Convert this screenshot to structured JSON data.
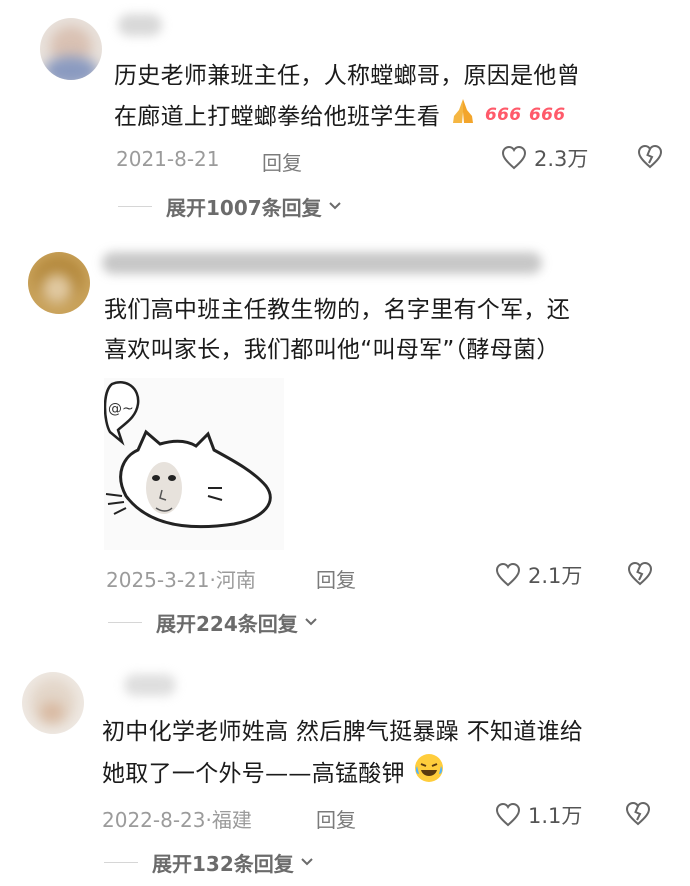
{
  "comments": [
    {
      "text_line1": "历史老师兼班主任，人称螳螂哥，原因是他曾",
      "text_line2": "在廊道上打螳螂拳给他班学生看",
      "emojis": [
        "praying-hands-emoji",
        "666-emoji",
        "666-emoji"
      ],
      "date": "2021-8-21",
      "location": "",
      "reply_label": "回复",
      "likes": "2.3万",
      "expand_label": "展开1007条回复"
    },
    {
      "text_line1": "我们高中班主任教生物的，名字里有个军，还",
      "text_line2": "喜欢叫家长，我们都叫他“叫母军”（酵母菌）",
      "sticker_text": "@~",
      "date": "2025-3-21·",
      "location": "河南",
      "reply_label": "回复",
      "likes": "2.1万",
      "expand_label": "展开224条回复"
    },
    {
      "text_line1": "初中化学老师姓高 然后脾气挺暴躁 不知道谁给",
      "text_line2": "她取了一个外号——高锰酸钾",
      "emojis": [
        "laughing-crying-emoji"
      ],
      "date": "2022-8-23·",
      "location": "福建",
      "reply_label": "回复",
      "likes": "1.1万",
      "expand_label": "展开132条回复"
    }
  ],
  "colors": {
    "text": "#1b1b1b",
    "meta": "#9b9b9b",
    "expand": "#6b6b6b"
  }
}
